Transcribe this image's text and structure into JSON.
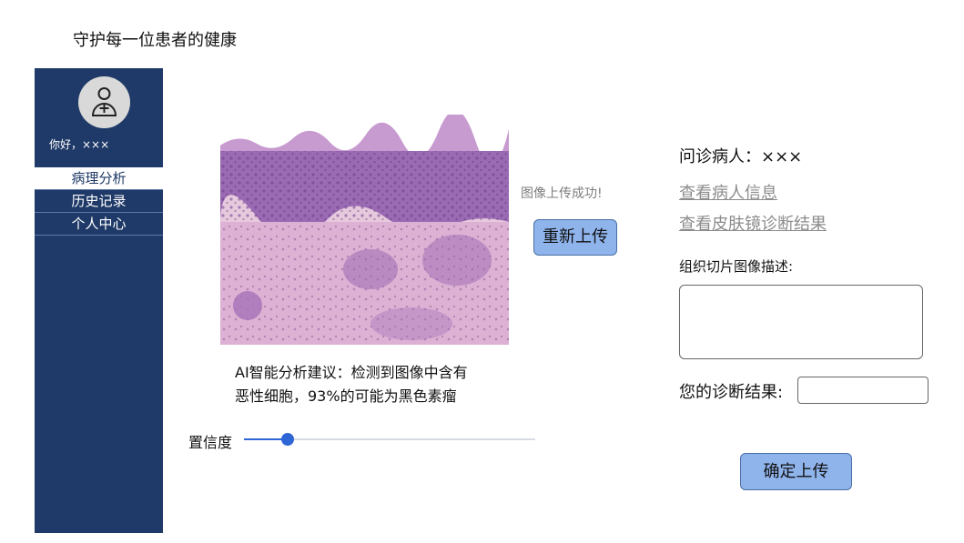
{
  "app": {
    "title": "守护每一位患者的健康"
  },
  "sidebar": {
    "greeting": "你好，×××",
    "items": [
      {
        "label": "病理分析",
        "active": true
      },
      {
        "label": "历史记录",
        "active": false
      },
      {
        "label": "个人中心",
        "active": false
      }
    ]
  },
  "upload": {
    "status": "图像上传成功!",
    "reupload_label": "重新上传"
  },
  "analysis": {
    "suggestion_line1": "AI智能分析建议：检测到图像中含有",
    "suggestion_line2": "恶性细胞，93%的可能为黑色素瘤",
    "confidence_label": "置信度",
    "confidence_level": 0.15
  },
  "patient_panel": {
    "patient": "问诊病人：×××",
    "view_info_link": "查看病人信息",
    "view_dermoscopy_link": "查看皮肤镜诊断结果",
    "description_label": "组织切片图像描述:",
    "description_value": "",
    "diagnosis_label": "您的诊断结果:",
    "diagnosis_value": "",
    "submit_label": "确定上传"
  },
  "colors": {
    "sidebar_bg": "#1f3a68",
    "button_bg": "#8fb4ec",
    "slider_accent": "#2f66d6"
  },
  "icons": {
    "avatar": "user-add-icon"
  }
}
